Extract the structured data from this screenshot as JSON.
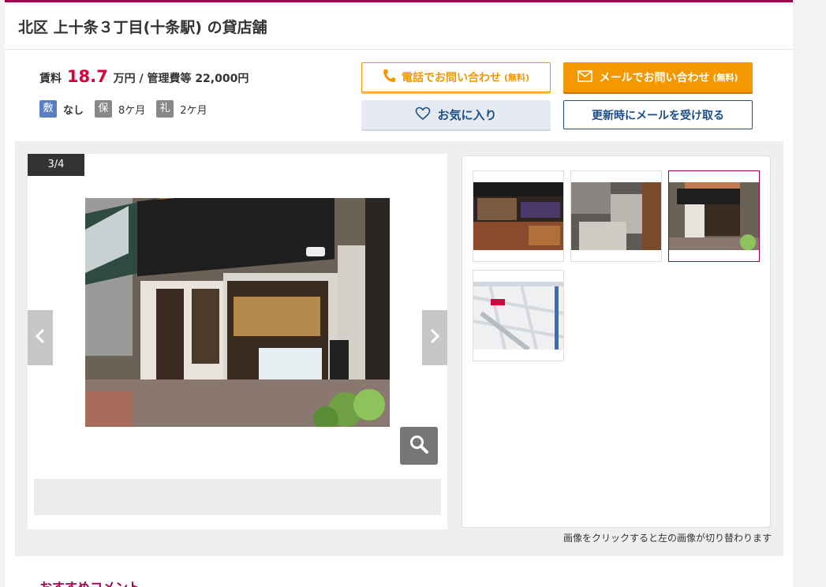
{
  "title": "北区 上十条３丁目(十条駅) の貸店舗",
  "rent": {
    "label": "賃料",
    "price": "18.7",
    "unit": "万円 / 管理費等 22,000円"
  },
  "terms": [
    {
      "badge": "敷",
      "value": "なし"
    },
    {
      "badge": "保",
      "value": "8ケ月"
    },
    {
      "badge": "礼",
      "value": "2ケ月"
    }
  ],
  "buttons": {
    "tel": "電話でお問い合わせ",
    "tel_note": "(無料)",
    "mail": "メールでお問い合わせ",
    "mail_note": "(無料)",
    "favorite": "お気に入り",
    "update_mail": "更新時にメールを受け取る"
  },
  "gallery": {
    "counter": "3/4",
    "hint": "画像をクリックすると左の画像が切り替わります"
  },
  "recommend_heading": "おすすめコメント",
  "colors": {
    "brand": "#a3004d",
    "accent_orange": "#f39800",
    "price_red": "#d7003a",
    "navy": "#1d4e89"
  },
  "icons": [
    "phone-icon",
    "mail-icon",
    "heart-icon",
    "chevron-left-icon",
    "chevron-right-icon",
    "search-icon"
  ]
}
